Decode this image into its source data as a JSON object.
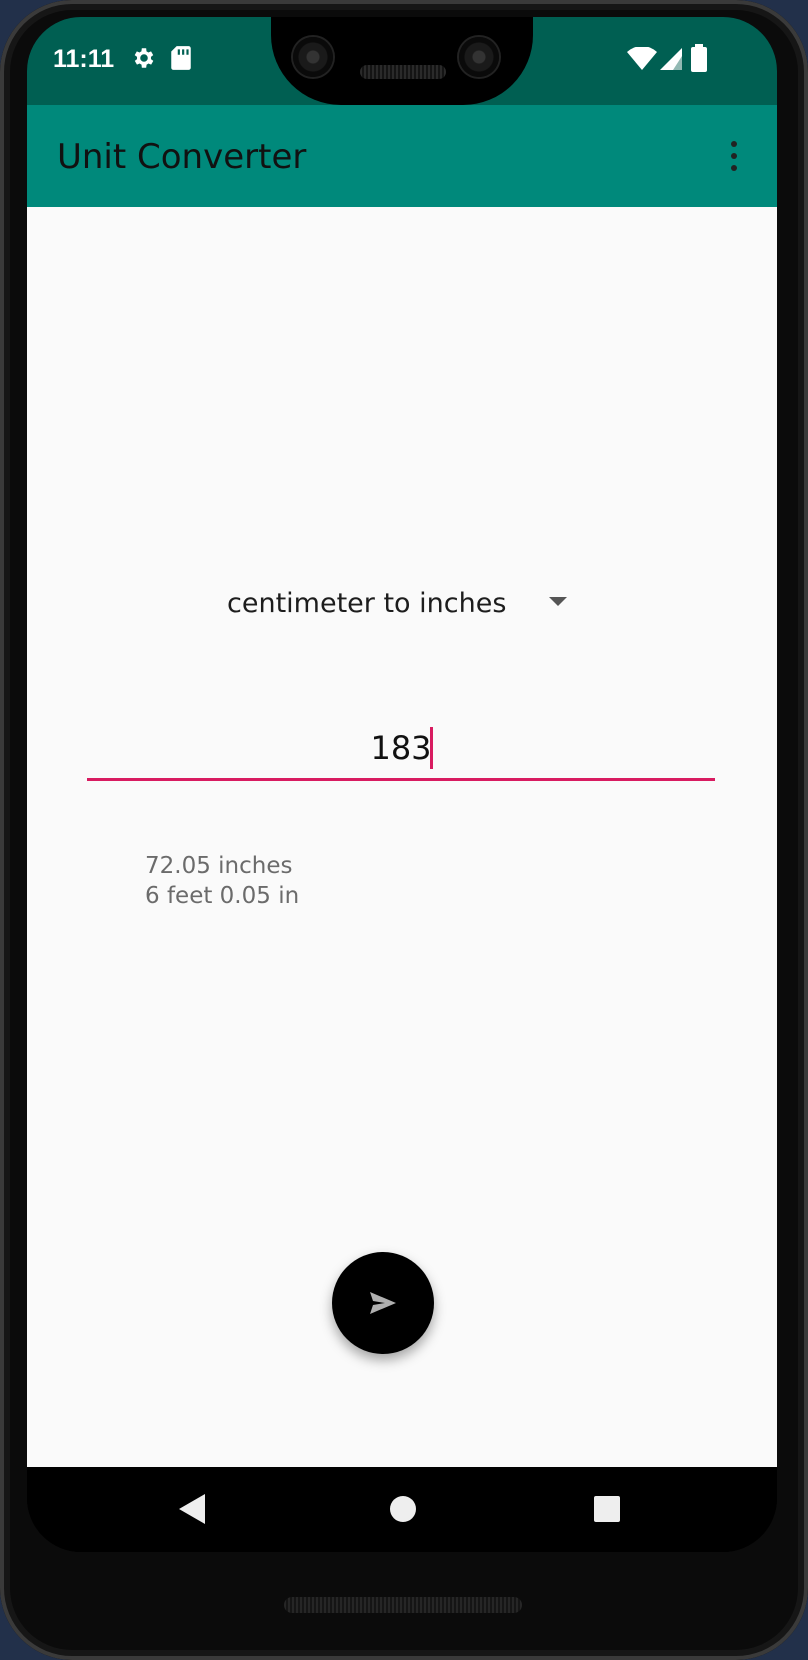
{
  "status_bar": {
    "time": "11:11",
    "icons": [
      "gear-icon",
      "sd-card-icon",
      "wifi-icon",
      "signal-icon",
      "battery-icon"
    ]
  },
  "app_bar": {
    "title": "Unit Converter",
    "overflow_icon": "more-vert-icon"
  },
  "converter": {
    "selected_conversion": "centimeter to inches",
    "input_value": "183",
    "result_line1": "72.05 inches",
    "result_line2": "6 feet 0.05 in"
  },
  "fab": {
    "icon": "send-icon"
  },
  "nav_bar": {
    "icons": [
      "back-icon",
      "home-icon",
      "recents-icon"
    ]
  },
  "colors": {
    "status_bar": "#005f52",
    "app_bar": "#00897b",
    "accent": "#d81b60",
    "background": "#fafafa",
    "fab": "#000000"
  }
}
